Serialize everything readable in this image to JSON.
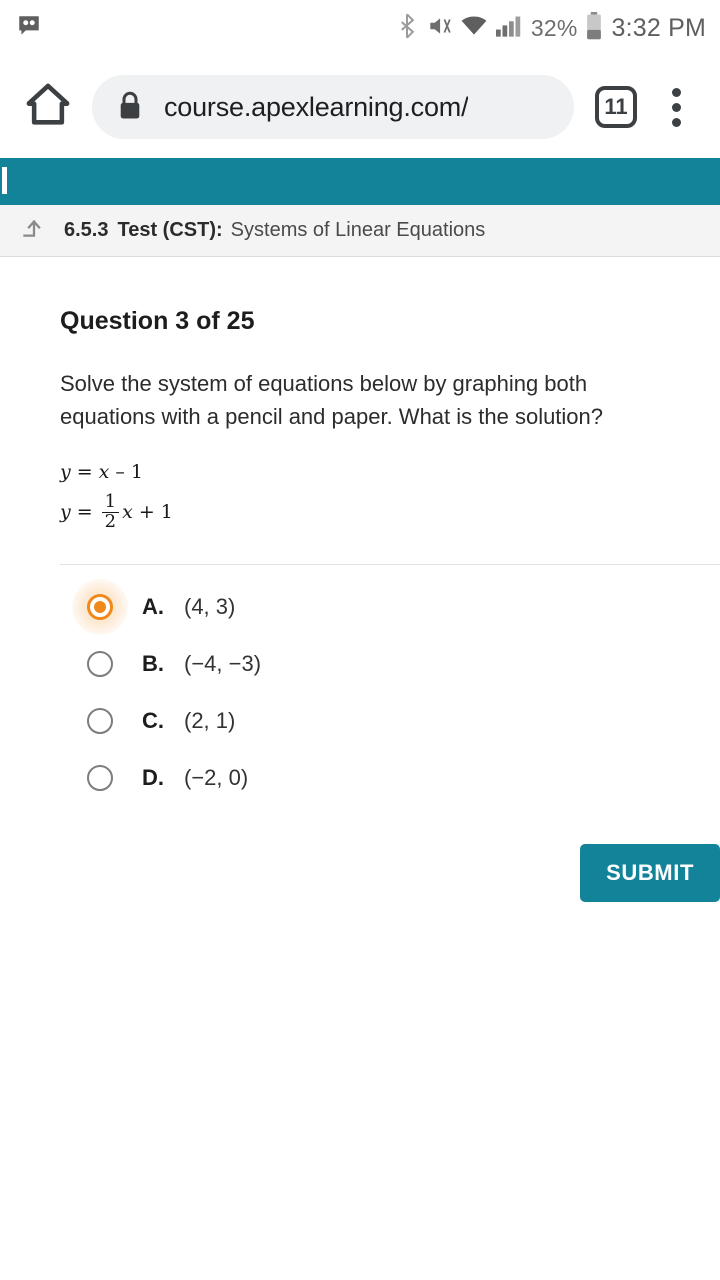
{
  "status_bar": {
    "notification_icon": "voicemail-icon",
    "bluetooth_icon": "bluetooth-icon",
    "mute_icon": "volume-muted-icon",
    "wifi_icon": "wifi-icon",
    "signal_icon": "cell-signal-icon",
    "battery_percent": "32%",
    "battery_icon": "battery-icon",
    "time": "3:32 PM"
  },
  "browser": {
    "home_icon": "home-icon",
    "lock_icon": "lock-icon",
    "url": "course.apexlearning.com/",
    "tab_count": "11",
    "menu_icon": "overflow-menu-icon"
  },
  "app_header": {
    "accent_color": "#13839a"
  },
  "breadcrumb": {
    "up_icon": "arrow-up-level-icon",
    "code": "6.5.3",
    "type": "Test (CST):",
    "title": "Systems of Linear Equations"
  },
  "question": {
    "heading": "Question 3 of 25",
    "prompt": "Solve the system of equations below by graphing both equations with a pencil and paper. What is the solution?",
    "equations": [
      {
        "lhs": "y",
        "eq": "=",
        "rhs_var": "x",
        "op": "–",
        "constant": "1"
      },
      {
        "lhs": "y",
        "eq": "=",
        "numerator": "1",
        "denominator": "2",
        "rhs_var": "x",
        "op": "+",
        "constant": "1"
      }
    ],
    "equation_text": [
      "y = x – 1",
      "y = 1/2 x + 1"
    ]
  },
  "options": [
    {
      "letter": "A.",
      "text": "(4, 3)",
      "selected": true
    },
    {
      "letter": "B.",
      "text": "(−4, −3)",
      "selected": false
    },
    {
      "letter": "C.",
      "text": "(2, 1)",
      "selected": false
    },
    {
      "letter": "D.",
      "text": "(−2, 0)",
      "selected": false
    }
  ],
  "submit": {
    "label": "SUBMIT"
  },
  "colors": {
    "teal": "#13839a",
    "orange": "#f0891c",
    "text_dark": "#1d1d1d"
  }
}
